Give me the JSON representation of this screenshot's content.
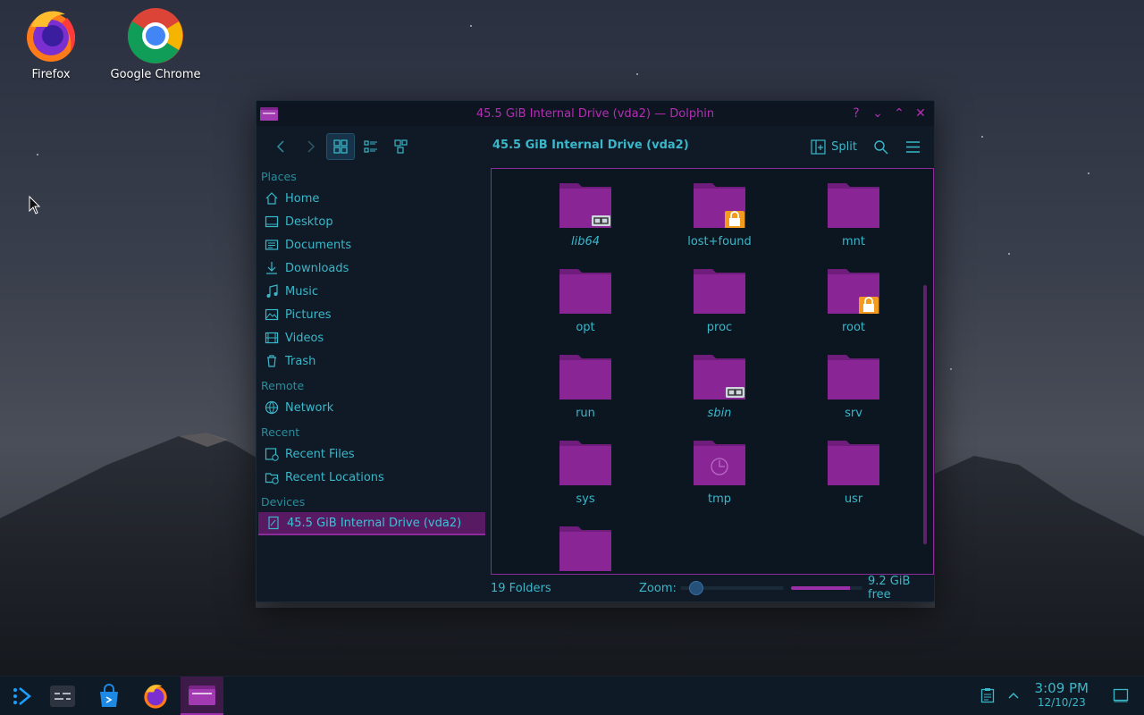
{
  "desktop": {
    "icons": [
      {
        "label": "Firefox"
      },
      {
        "label": "Google Chrome"
      }
    ]
  },
  "window": {
    "title": "45.5 GiB Internal Drive (vda2) — Dolphin",
    "controls": [
      "?",
      "minimize",
      "maximize",
      "close"
    ],
    "toolbar": {
      "path": "45.5 GiB Internal Drive (vda2)",
      "split_label": "Split"
    },
    "sidebar": {
      "places_header": "Places",
      "places": [
        "Home",
        "Desktop",
        "Documents",
        "Downloads",
        "Music",
        "Pictures",
        "Videos",
        "Trash"
      ],
      "remote_header": "Remote",
      "remote": [
        "Network"
      ],
      "recent_header": "Recent",
      "recent": [
        "Recent Files",
        "Recent Locations"
      ],
      "devices_header": "Devices",
      "devices": [
        "45.5 GiB Internal Drive (vda2)"
      ]
    },
    "folders": [
      {
        "name": "lib64",
        "italic": true,
        "emblem": "symlink"
      },
      {
        "name": "lost+found",
        "italic": false,
        "emblem": "lock"
      },
      {
        "name": "mnt",
        "italic": false,
        "emblem": ""
      },
      {
        "name": "opt",
        "italic": false,
        "emblem": ""
      },
      {
        "name": "proc",
        "italic": false,
        "emblem": ""
      },
      {
        "name": "root",
        "italic": false,
        "emblem": "lock"
      },
      {
        "name": "run",
        "italic": false,
        "emblem": ""
      },
      {
        "name": "sbin",
        "italic": true,
        "emblem": "symlink"
      },
      {
        "name": "srv",
        "italic": false,
        "emblem": ""
      },
      {
        "name": "sys",
        "italic": false,
        "emblem": ""
      },
      {
        "name": "tmp",
        "italic": false,
        "emblem": "clock"
      },
      {
        "name": "usr",
        "italic": false,
        "emblem": ""
      },
      {
        "name": "",
        "italic": false,
        "emblem": ""
      }
    ],
    "statusbar": {
      "count": "19 Folders",
      "zoom_label": "Zoom:",
      "free_label": "9.2 GiB free",
      "free_used_fraction": 0.82,
      "zoom_level_fraction": 0.22
    }
  },
  "taskbar": {
    "clock_time": "3:09 PM",
    "clock_date": "12/10/23"
  },
  "colors": {
    "accent_text": "#3ab7c9",
    "title_magenta": "#b52db4",
    "folder": "#8a2596",
    "folder_tab": "#6e1d7a",
    "selection": "#581a62"
  }
}
